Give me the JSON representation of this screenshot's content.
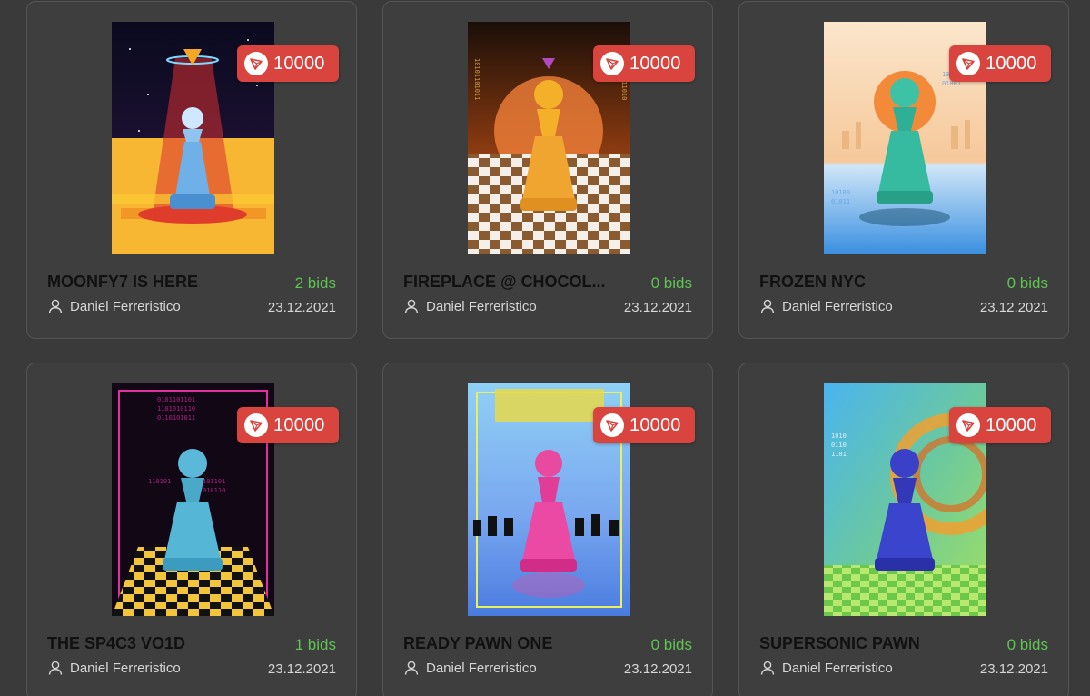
{
  "currency_icon": "tron-icon",
  "accent_color": "#d9443e",
  "bids_color": "#5fc253",
  "cards": [
    {
      "title": "MOONFY7 IS HERE",
      "price": "10000",
      "bids": "2 bids",
      "owner": "Daniel Ferreristico",
      "date": "23.12.2021"
    },
    {
      "title": "FIREPLACE @ CHOCOL...",
      "price": "10000",
      "bids": "0 bids",
      "owner": "Daniel Ferreristico",
      "date": "23.12.2021"
    },
    {
      "title": "FROZEN NYC",
      "price": "10000",
      "bids": "0 bids",
      "owner": "Daniel Ferreristico",
      "date": "23.12.2021"
    },
    {
      "title": "THE SP4C3 VO1D",
      "price": "10000",
      "bids": "1 bids",
      "owner": "Daniel Ferreristico",
      "date": "23.12.2021"
    },
    {
      "title": "READY PAWN ONE",
      "price": "10000",
      "bids": "0 bids",
      "owner": "Daniel Ferreristico",
      "date": "23.12.2021"
    },
    {
      "title": "SUPERSONIC PAWN",
      "price": "10000",
      "bids": "0 bids",
      "owner": "Daniel Ferreristico",
      "date": "23.12.2021"
    }
  ]
}
